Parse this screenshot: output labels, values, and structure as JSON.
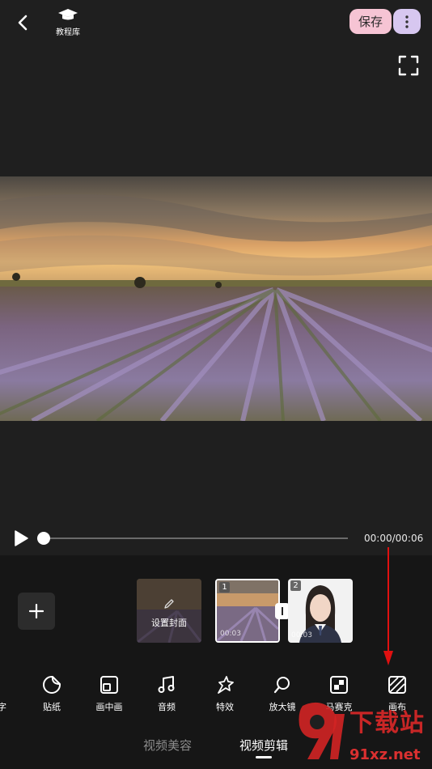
{
  "topbar": {
    "tutorial_label": "教程库",
    "save_label": "保存"
  },
  "player": {
    "time": "00:00/00:06",
    "progress": 0
  },
  "timeline": {
    "cover_label": "设置封面",
    "clips": [
      {
        "number": "1",
        "duration": "00:03"
      },
      {
        "number": "2",
        "duration": "00:03"
      }
    ]
  },
  "tools": [
    {
      "label": "字",
      "icon": "text-icon"
    },
    {
      "label": "贴纸",
      "icon": "sticker-icon"
    },
    {
      "label": "画中画",
      "icon": "picture-in-picture-icon"
    },
    {
      "label": "音频",
      "icon": "music-icon"
    },
    {
      "label": "特效",
      "icon": "effects-icon"
    },
    {
      "label": "放大镜",
      "icon": "magnifier-icon"
    },
    {
      "label": "马赛克",
      "icon": "mosaic-icon"
    },
    {
      "label": "画布",
      "icon": "canvas-icon"
    }
  ],
  "tabs": {
    "beauty": "视频美容",
    "edit": "视频剪辑"
  },
  "watermark": {
    "text": "下载站",
    "url": "91xz.net"
  },
  "colors": {
    "background": "#1f1f1f",
    "save_button": "#f6c4d4",
    "more_button": "#d7c7f0",
    "annotation_arrow": "#e01010"
  }
}
